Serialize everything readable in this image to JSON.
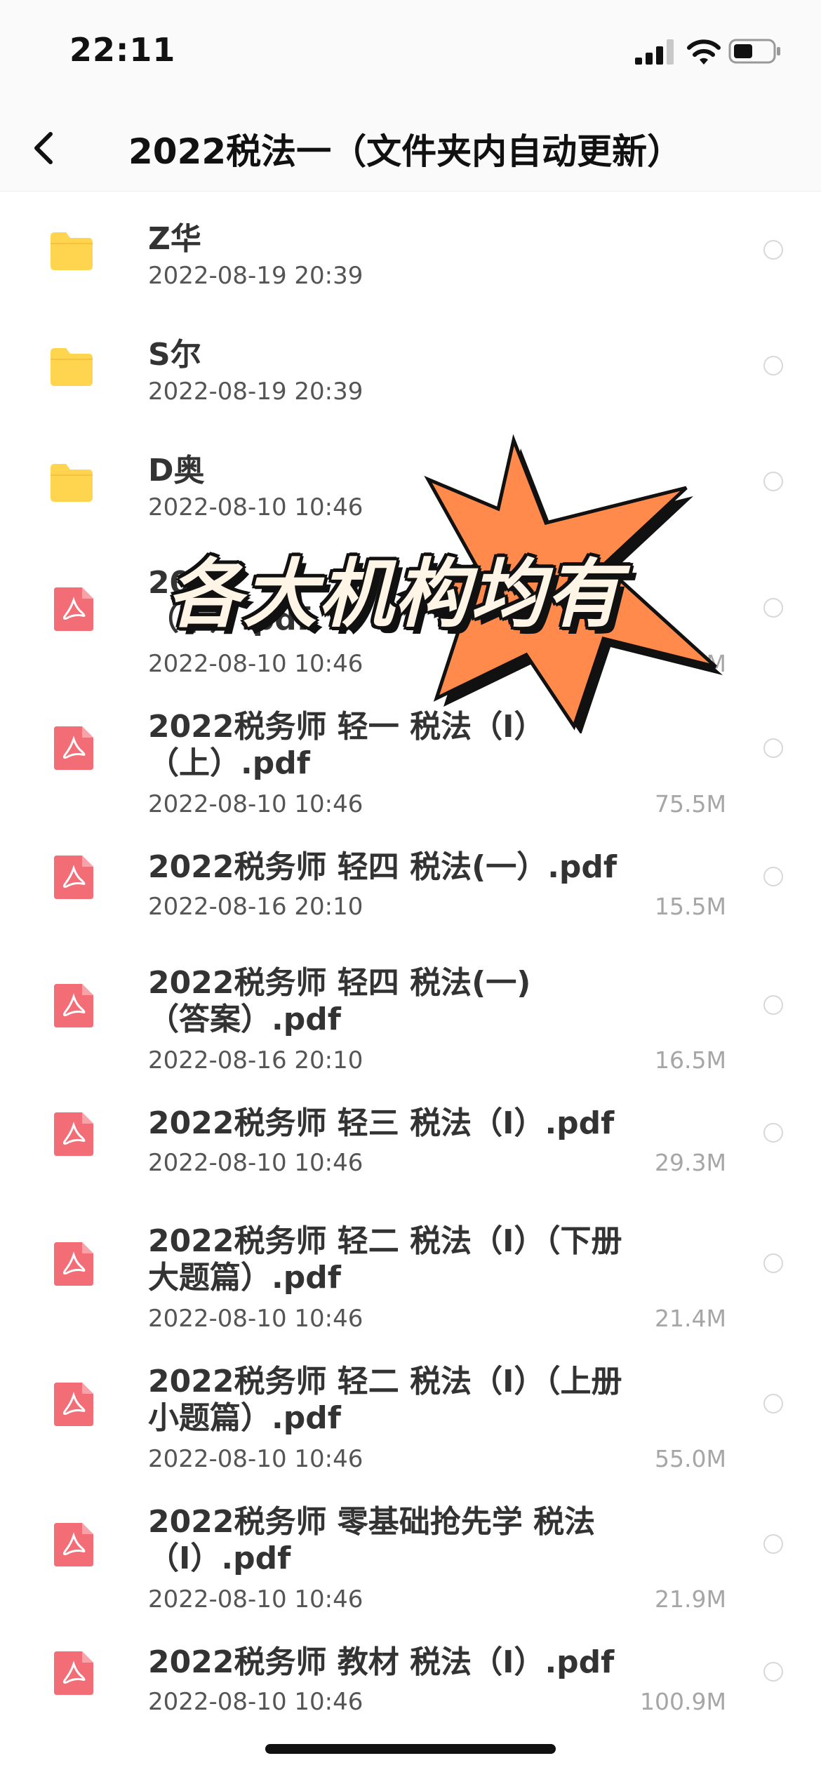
{
  "status_bar": {
    "time": "22:11"
  },
  "nav": {
    "back_icon": "chevron-left-icon",
    "title": "2022税法一（文件夹内自动更新）"
  },
  "colors": {
    "folder": "#FFD54F",
    "pdf": "#F26D75",
    "burst": "#FF8A4C"
  },
  "overlay": {
    "text": "各大机构均有"
  },
  "items": [
    {
      "type": "folder",
      "icon": "folder-icon",
      "name": "Z华",
      "date": "2022-08-19 20:39",
      "size": ""
    },
    {
      "type": "folder",
      "icon": "folder-icon",
      "name": "S尔",
      "date": "2022-08-19 20:39",
      "size": ""
    },
    {
      "type": "folder",
      "icon": "folder-icon",
      "name": "D奥",
      "date": "2022-08-10 10:46",
      "size": ""
    },
    {
      "type": "pdf",
      "icon": "pdf-icon",
      "name": "20\n（下）.pdf",
      "date": "2022-08-10 10:46",
      "size": "M"
    },
    {
      "type": "pdf",
      "icon": "pdf-icon",
      "name": "2022税务师 轻一 税法（I）\n（上）.pdf",
      "date": "2022-08-10 10:46",
      "size": "75.5M"
    },
    {
      "type": "pdf",
      "icon": "pdf-icon",
      "name": "2022税务师 轻四 税法(一）.pdf",
      "date": "2022-08-16 20:10",
      "size": "15.5M"
    },
    {
      "type": "pdf",
      "icon": "pdf-icon",
      "name": "2022税务师 轻四 税法(一)\n（答案）.pdf",
      "date": "2022-08-16 20:10",
      "size": "16.5M"
    },
    {
      "type": "pdf",
      "icon": "pdf-icon",
      "name": "2022税务师 轻三 税法（I）.pdf",
      "date": "2022-08-10 10:46",
      "size": "29.3M"
    },
    {
      "type": "pdf",
      "icon": "pdf-icon",
      "name": "2022税务师 轻二 税法（I）（下册\n大题篇）.pdf",
      "date": "2022-08-10 10:46",
      "size": "21.4M"
    },
    {
      "type": "pdf",
      "icon": "pdf-icon",
      "name": "2022税务师 轻二 税法（I）（上册\n小题篇）.pdf",
      "date": "2022-08-10 10:46",
      "size": "55.0M"
    },
    {
      "type": "pdf",
      "icon": "pdf-icon",
      "name": "2022税务师 零基础抢先学 税法\n（I）.pdf",
      "date": "2022-08-10 10:46",
      "size": "21.9M"
    },
    {
      "type": "pdf",
      "icon": "pdf-icon",
      "name": "2022税务师 教材 税法（I）.pdf",
      "date": "2022-08-10 10:46",
      "size": "100.9M"
    }
  ]
}
